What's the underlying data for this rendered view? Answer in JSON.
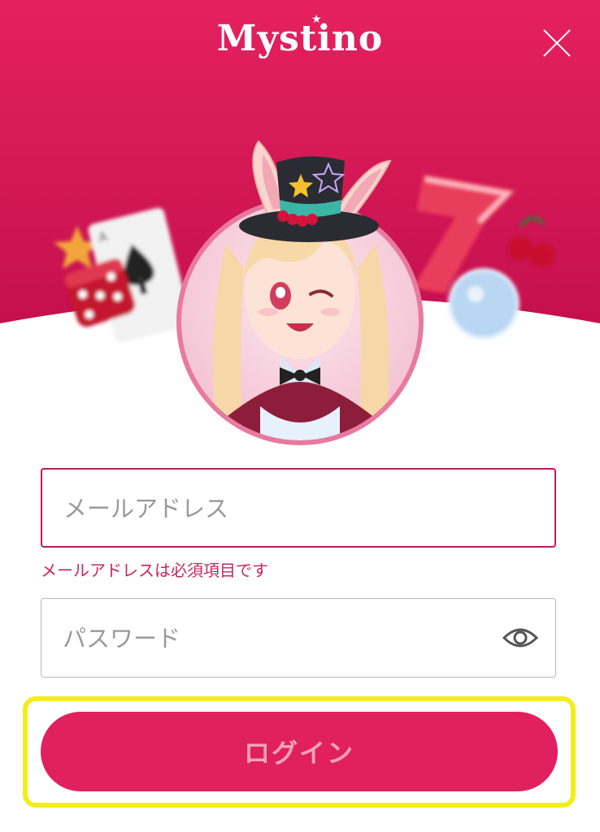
{
  "header": {
    "brand": "Mystino",
    "close_icon": "close-icon"
  },
  "colors": {
    "brand_pink": "#e1205f",
    "error": "#c7265f",
    "highlight": "#f2ee1d"
  },
  "form": {
    "email": {
      "placeholder": "メールアドレス",
      "value": "",
      "error": "メールアドレスは必須項目です"
    },
    "password": {
      "placeholder": "パスワード",
      "value": "",
      "toggle_icon": "eye-icon"
    },
    "login_label": "ログイン"
  }
}
